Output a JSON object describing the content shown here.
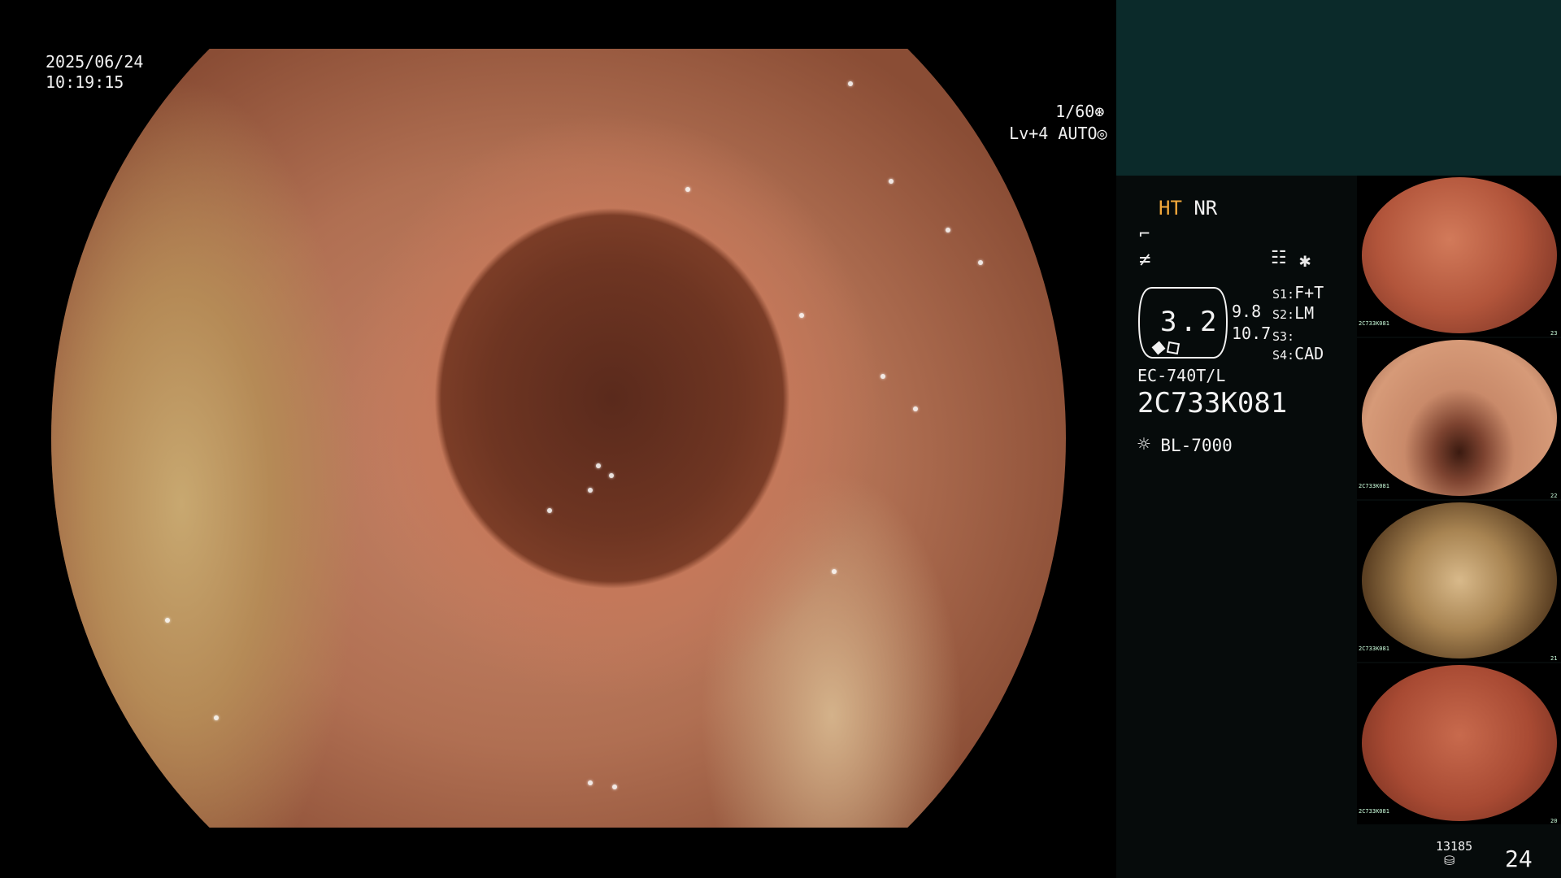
{
  "osd": {
    "date": "2025/06/24",
    "time": "10:19:15",
    "shutter": "1/60",
    "level": "Lv+4 AUTO"
  },
  "status_panel": {
    "mode_ht": "HT",
    "mode_nr": "NR",
    "zoom_value": "3.2",
    "val_a": "9.8",
    "val_b": "10.7",
    "scope_model": "EC-740T/L",
    "scope_serial": "2C733K081",
    "light_source": "BL-7000",
    "switches": [
      {
        "key": "S1:",
        "value": "F+T"
      },
      {
        "key": "S2:",
        "value": "LM"
      },
      {
        "key": "S3:",
        "value": ""
      },
      {
        "key": "S4:",
        "value": "CAD"
      }
    ],
    "capture_count": "13185",
    "page_number": "24"
  },
  "thumbnails": [
    {
      "label": "2C733K081",
      "index": "23"
    },
    {
      "label": "2C733K081",
      "index": "22"
    },
    {
      "label": "2C733K081",
      "index": "21"
    },
    {
      "label": "2C733K081",
      "index": "20"
    }
  ],
  "colors": {
    "accent_ht": "#f2a93b",
    "panel_header": "#0b2a2a",
    "panel_bg": "#060b0b"
  }
}
